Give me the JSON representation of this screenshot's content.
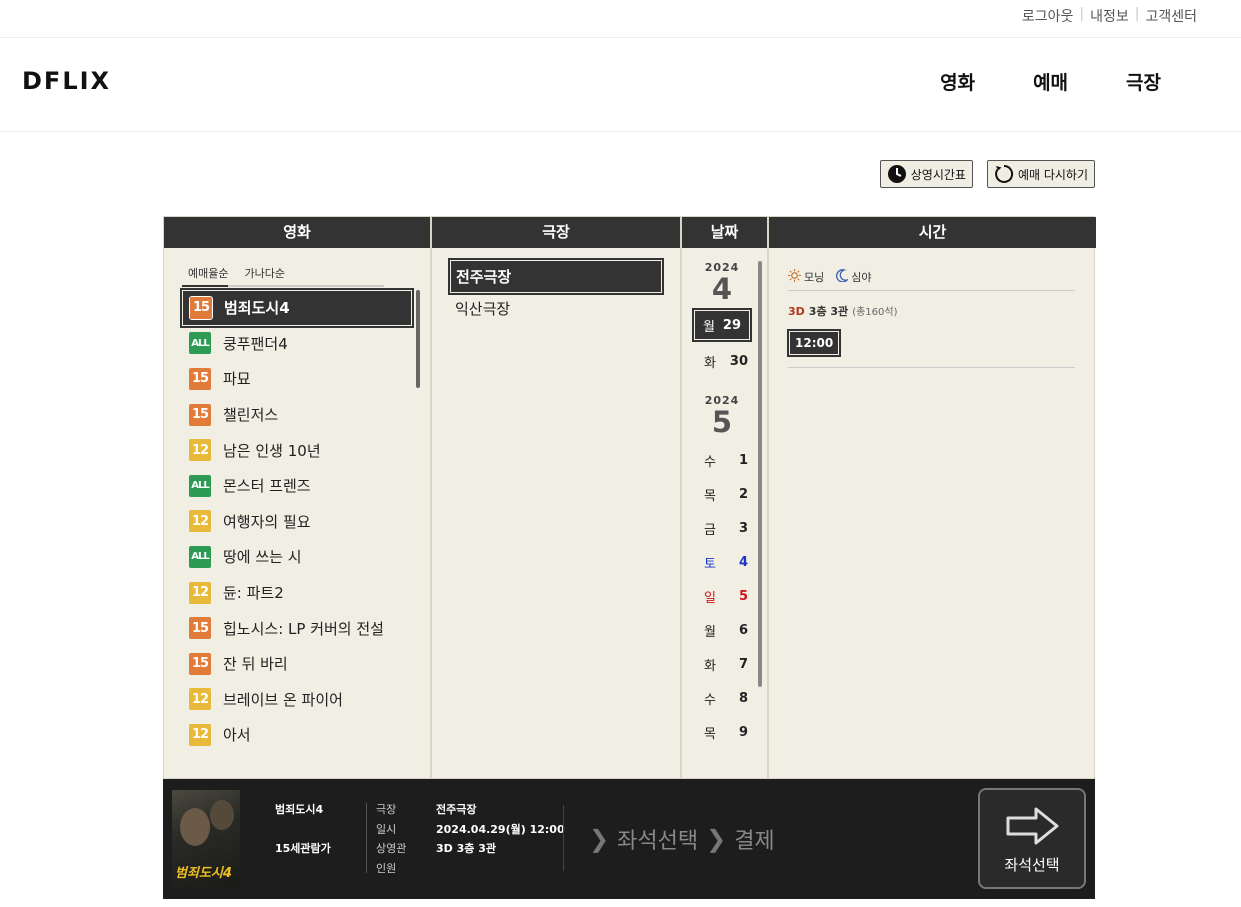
{
  "util_links": {
    "logout": "로그아웃",
    "myinfo": "내정보",
    "support": "고객센터"
  },
  "header": {
    "logo": "DFLIX",
    "nav": [
      "영화",
      "예매",
      "극장"
    ]
  },
  "actions": {
    "schedule": "상영시간표",
    "reset": "예매 다시하기"
  },
  "columns": {
    "movie": "영화",
    "theater": "극장",
    "date": "날짜",
    "time": "시간"
  },
  "sort_tabs": [
    "예매율순",
    "가나다순"
  ],
  "movies": [
    {
      "rating": "15",
      "title": "범죄도시4"
    },
    {
      "rating": "ALL",
      "title": "쿵푸팬더4"
    },
    {
      "rating": "15",
      "title": "파묘"
    },
    {
      "rating": "15",
      "title": "챌린저스"
    },
    {
      "rating": "12",
      "title": "남은 인생 10년"
    },
    {
      "rating": "ALL",
      "title": "몬스터 프렌즈"
    },
    {
      "rating": "12",
      "title": "여행자의 필요"
    },
    {
      "rating": "ALL",
      "title": "땅에 쓰는 시"
    },
    {
      "rating": "12",
      "title": "듄: 파트2"
    },
    {
      "rating": "15",
      "title": "힙노시스: LP 커버의 전설"
    },
    {
      "rating": "15",
      "title": "잔 뒤 바리"
    },
    {
      "rating": "12",
      "title": "브레이브 온 파이어"
    },
    {
      "rating": "12",
      "title": "아서"
    }
  ],
  "theaters": [
    "전주극장",
    "익산극장"
  ],
  "dates": {
    "year1": "2024",
    "month1": "4",
    "days1": [
      {
        "dow": "월",
        "d": "29"
      },
      {
        "dow": "화",
        "d": "30"
      }
    ],
    "year2": "2024",
    "month2": "5",
    "days2": [
      {
        "dow": "수",
        "d": "1"
      },
      {
        "dow": "목",
        "d": "2"
      },
      {
        "dow": "금",
        "d": "3"
      },
      {
        "dow": "토",
        "d": "4"
      },
      {
        "dow": "일",
        "d": "5"
      },
      {
        "dow": "월",
        "d": "6"
      },
      {
        "dow": "화",
        "d": "7"
      },
      {
        "dow": "수",
        "d": "8"
      },
      {
        "dow": "목",
        "d": "9"
      }
    ]
  },
  "time_panel": {
    "morning": "모닝",
    "night": "심야",
    "format": "3D",
    "hall": "3층 3관",
    "seats": "(총160석)",
    "showtime": "12:00"
  },
  "summary": {
    "movie": "범죄도시4",
    "rating_label": "15세관람가",
    "poster_title": "범죄도시4",
    "info": [
      {
        "k": "극장",
        "v": "전주극장"
      },
      {
        "k": "일시",
        "v": "2024.04.29(월) 12:00"
      },
      {
        "k": "상영관",
        "v": "3D 3층 3관"
      },
      {
        "k": "인원",
        "v": ""
      }
    ],
    "step_seat": "좌석선택",
    "step_pay": "결제",
    "next_label": "좌석선택"
  },
  "colors": {
    "dark": "#333333",
    "panel": "#f1eee4",
    "r15": "#e07b3a",
    "r12": "#e8b93a",
    "rall": "#2e9b55"
  }
}
